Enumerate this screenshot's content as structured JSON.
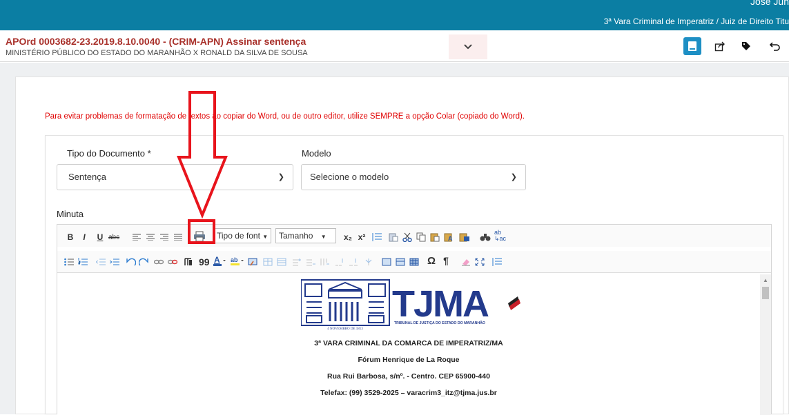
{
  "topbar": {
    "user": "José Jun",
    "court": "3ª Vara Criminal de Imperatriz / Juiz de Direito Titu"
  },
  "header": {
    "title": "APOrd 0003682-23.2019.8.10.0040 - (CRIM-APN) Assinar sentença",
    "subtitle": "MINISTÉRIO PÚBLICO DO ESTADO DO MARANHÃO X RONALD DA SILVA DE SOUSA",
    "expand_icon": "chevron-down-icon",
    "actions": [
      "document-icon",
      "share-icon",
      "tag-icon",
      "undo-icon"
    ]
  },
  "warning": "Para evitar problemas de formatação de textos ao copiar do Word, ou de outro editor, utilize SEMPRE a opção Colar (copiado do Word).",
  "form": {
    "tipo_label": "Tipo do Documento *",
    "tipo_value": "Sentença",
    "modelo_label": "Modelo",
    "modelo_value": "Selecione o modelo",
    "minuta_label": "Minuta"
  },
  "toolbar": {
    "bold": "B",
    "italic": "I",
    "underline": "U",
    "strike": "abc",
    "font_label": "Tipo de font",
    "size_label": "Tamanho",
    "subscript": "x₂",
    "superscript": "x²",
    "pilcrow": "¶",
    "omega": "Ω",
    "quote": "99"
  },
  "document": {
    "logo_text": "TJMA",
    "logo_caption": "TRIBUNAL DE JUSTIÇA DO ESTADO DO MARANHÃO",
    "logo_date": "4 NOVEMBRO DE 1813",
    "lines": [
      "3ª VARA CRIMINAL DA COMARCA DE IMPERATRIZ/MA",
      "Fórum Henrique de La Roque",
      "Rua Rui Barbosa, s/nº. - Centro. CEP 65900-440",
      "Telefax: (99) 3529-2025 – varacrim3_itz@tjma.jus.br"
    ]
  },
  "colors": {
    "topbar": "#0b7ea3",
    "title": "#a9312b",
    "warning": "#e00000",
    "annotation": "#e8141c",
    "logo_blue": "#233a8c"
  }
}
